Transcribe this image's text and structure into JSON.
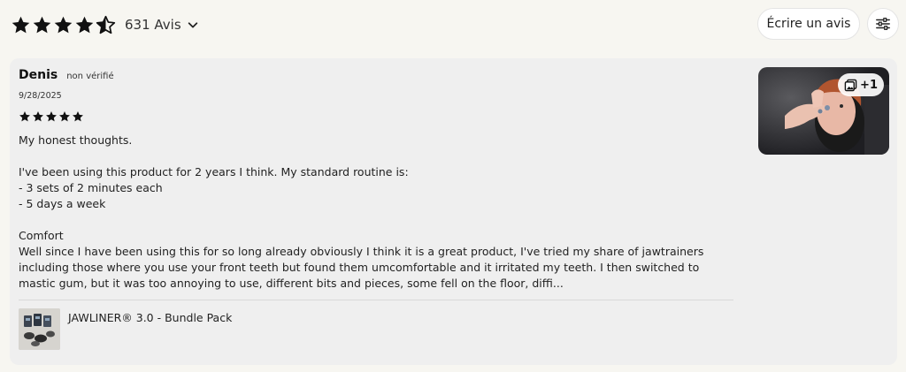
{
  "header": {
    "rating": 4.5,
    "review_count_label": "631 Avis",
    "write_review_label": "Écrire un avis",
    "icons": {
      "rating_dropdown": "chevron-down-icon",
      "filter": "sliders-icon"
    }
  },
  "review": {
    "author": "Denis",
    "verified_label": "non vérifié",
    "date": "9/28/2025",
    "rating": 5,
    "body": "My honest thoughts.\n\nI've been using this product for 2 years I think. My standard routine is:\n- 3 sets of 2 minutes each\n- 5 days a week\n\nComfort\nWell since I have been using this for so long already obviously I think it is a great product, I've tried my share of jawtrainers including those where you use your front teeth but found them umcomfortable and it irritated my teeth. I then switched to mastic gum, but it was too annoying to use, different bits and pieces, some fell on the floor, diffi...",
    "photo_extra_count": "+1",
    "photo_icon": "gallery-icon",
    "product_name": "JAWLINER® 3.0 - Bundle Pack"
  },
  "colors": {
    "page_background": "#f7f6f1",
    "card_background": "#efefef",
    "stars": "#111111"
  }
}
